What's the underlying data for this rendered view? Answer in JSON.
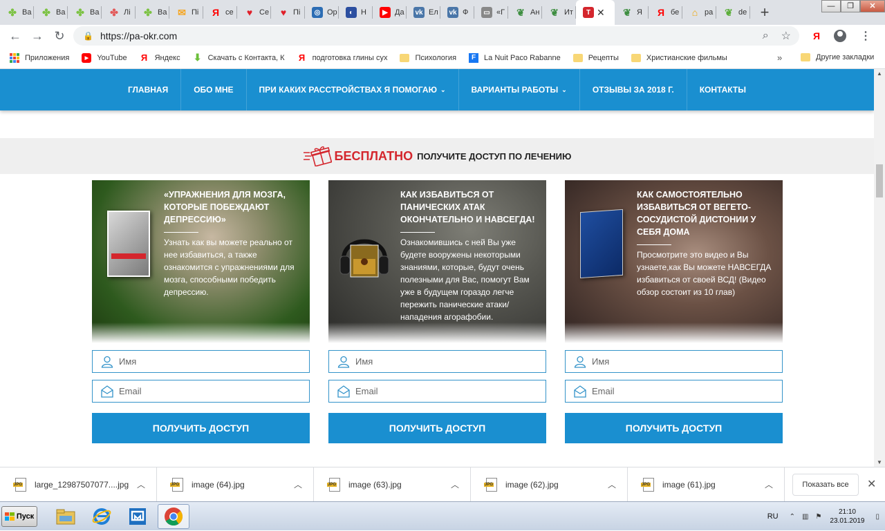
{
  "browser": {
    "tabs": [
      {
        "label": "Ва",
        "icon": "clover-icon",
        "color": "#7cc243"
      },
      {
        "label": "Ва",
        "icon": "clover-icon",
        "color": "#7cc243"
      },
      {
        "label": "Ва",
        "icon": "clover-icon",
        "color": "#7cc243"
      },
      {
        "label": "Лi",
        "icon": "clover-multi-icon",
        "color": "#e25a5a"
      },
      {
        "label": "Ва",
        "icon": "clover-icon",
        "color": "#7cc243"
      },
      {
        "label": "Пi",
        "icon": "mail-icon",
        "color": "#f5a623"
      },
      {
        "label": "се",
        "icon": "yandex-icon",
        "color": "#ff0000"
      },
      {
        "label": "Се",
        "icon": "heart-icon",
        "color": "#e0202a"
      },
      {
        "label": "Пi",
        "icon": "heart-icon",
        "color": "#e0202a"
      },
      {
        "label": "Ор",
        "icon": "globe-icon",
        "color": "#2c6db4"
      },
      {
        "label": "Н",
        "icon": "moon-icon",
        "color": "#2c4fa0"
      },
      {
        "label": "Да",
        "icon": "youtube-icon",
        "color": "#ff0000"
      },
      {
        "label": "Ел",
        "icon": "vk-icon",
        "color": "#4a76a8"
      },
      {
        "label": "Ф",
        "icon": "vk-icon",
        "color": "#4a76a8"
      },
      {
        "label": "«Г",
        "icon": "page-icon",
        "color": "#888888"
      },
      {
        "label": "Ан",
        "icon": "leaf-icon",
        "color": "#3e8e41"
      },
      {
        "label": "Ит",
        "icon": "leaf-icon",
        "color": "#3e8e41"
      },
      {
        "label": "",
        "icon": "site-icon",
        "color": "#d4262d",
        "active": true
      },
      {
        "label": "Я",
        "icon": "leaf-icon",
        "color": "#3e8e41"
      },
      {
        "label": "бе",
        "icon": "yandex-icon",
        "color": "#ff0000"
      },
      {
        "label": "ра",
        "icon": "house-icon",
        "color": "#f0a500"
      },
      {
        "label": "de",
        "icon": "leaf-icon",
        "color": "#5cae3b"
      }
    ],
    "url": "https://pa-okr.com",
    "yandex_letter": "Я"
  },
  "bookmarks": {
    "items": [
      {
        "label": "Приложения",
        "icon": "apps-grid-icon"
      },
      {
        "label": "YouTube",
        "icon": "youtube-icon"
      },
      {
        "label": "Яндекс",
        "icon": "yandex-icon"
      },
      {
        "label": "Скачать с Контакта, К",
        "icon": "download-arrow-icon"
      },
      {
        "label": "подготовка глины сух",
        "icon": "yandex-icon"
      },
      {
        "label": "Психология",
        "icon": "folder-icon"
      },
      {
        "label": "La Nuit Paco Rabanne",
        "icon": "f-letter-icon"
      },
      {
        "label": "Рецепты",
        "icon": "folder-icon"
      },
      {
        "label": "Христианские фильмы",
        "icon": "folder-icon"
      }
    ],
    "more": "»",
    "other": "Другие закладки"
  },
  "site": {
    "nav": [
      {
        "label": "ГЛАВНАЯ",
        "dropdown": false
      },
      {
        "label": "ОБО МНЕ",
        "dropdown": false
      },
      {
        "label": "ПРИ КАКИХ РАССТРОЙСТВАХ Я ПОМОГАЮ",
        "dropdown": true
      },
      {
        "label": "ВАРИАНТЫ РАБОТЫ",
        "dropdown": true
      },
      {
        "label": "ОТЗЫВЫ ЗА 2018 Г.",
        "dropdown": false
      },
      {
        "label": "КОНТАКТЫ",
        "dropdown": false
      }
    ],
    "banner": {
      "free": "БЕСПЛАТНО",
      "rest": "ПОЛУЧИТЕ ДОСТУП ПО ЛЕЧЕНИЮ"
    },
    "cards": [
      {
        "title": "«Упражнения для мозга, которые побеждают депрессию»",
        "desc": "Узнать как вы можете реально от нее избавиться, а также ознакомится с упражнениями для мозга, способными победить депрессию.",
        "name_placeholder": "Имя",
        "email_placeholder": "Email",
        "button": "Получить доступ"
      },
      {
        "title": "Как избавиться от панических атак окончательно и навсегда!",
        "desc": "Ознакомившись с ней Вы уже будете вооружены некоторыми знаниями, которые, будут очень полезными для Вас, помогут Вам уже в будущем гораздо легче пережить панические атаки/нападения агорафобии.",
        "name_placeholder": "Имя",
        "email_placeholder": "Email",
        "button": "Получить доступ"
      },
      {
        "title": "Как самостоятельно избавиться от вегето-сосудистой дистонии у себя дома",
        "desc": "Просмотрите это видео и Вы узнаете,как Вы можете НАВСЕГДА избавиться от своей ВСД! (Видео обзор состоит из 10 глав)",
        "name_placeholder": "Имя",
        "email_placeholder": "Email",
        "button": "Получить доступ"
      }
    ],
    "colors": {
      "nav": "#1a8fd0",
      "accent_red": "#d4262d",
      "button": "#1a8fd0"
    }
  },
  "downloads": {
    "items": [
      {
        "name": "large_12987507077....jpg"
      },
      {
        "name": "image (64).jpg"
      },
      {
        "name": "image (63).jpg"
      },
      {
        "name": "image (62).jpg"
      },
      {
        "name": "image (61).jpg"
      }
    ],
    "show_all": "Показать все"
  },
  "taskbar": {
    "start": "Пуск",
    "lang": "RU",
    "time": "21:10",
    "date": "23.01.2019"
  }
}
